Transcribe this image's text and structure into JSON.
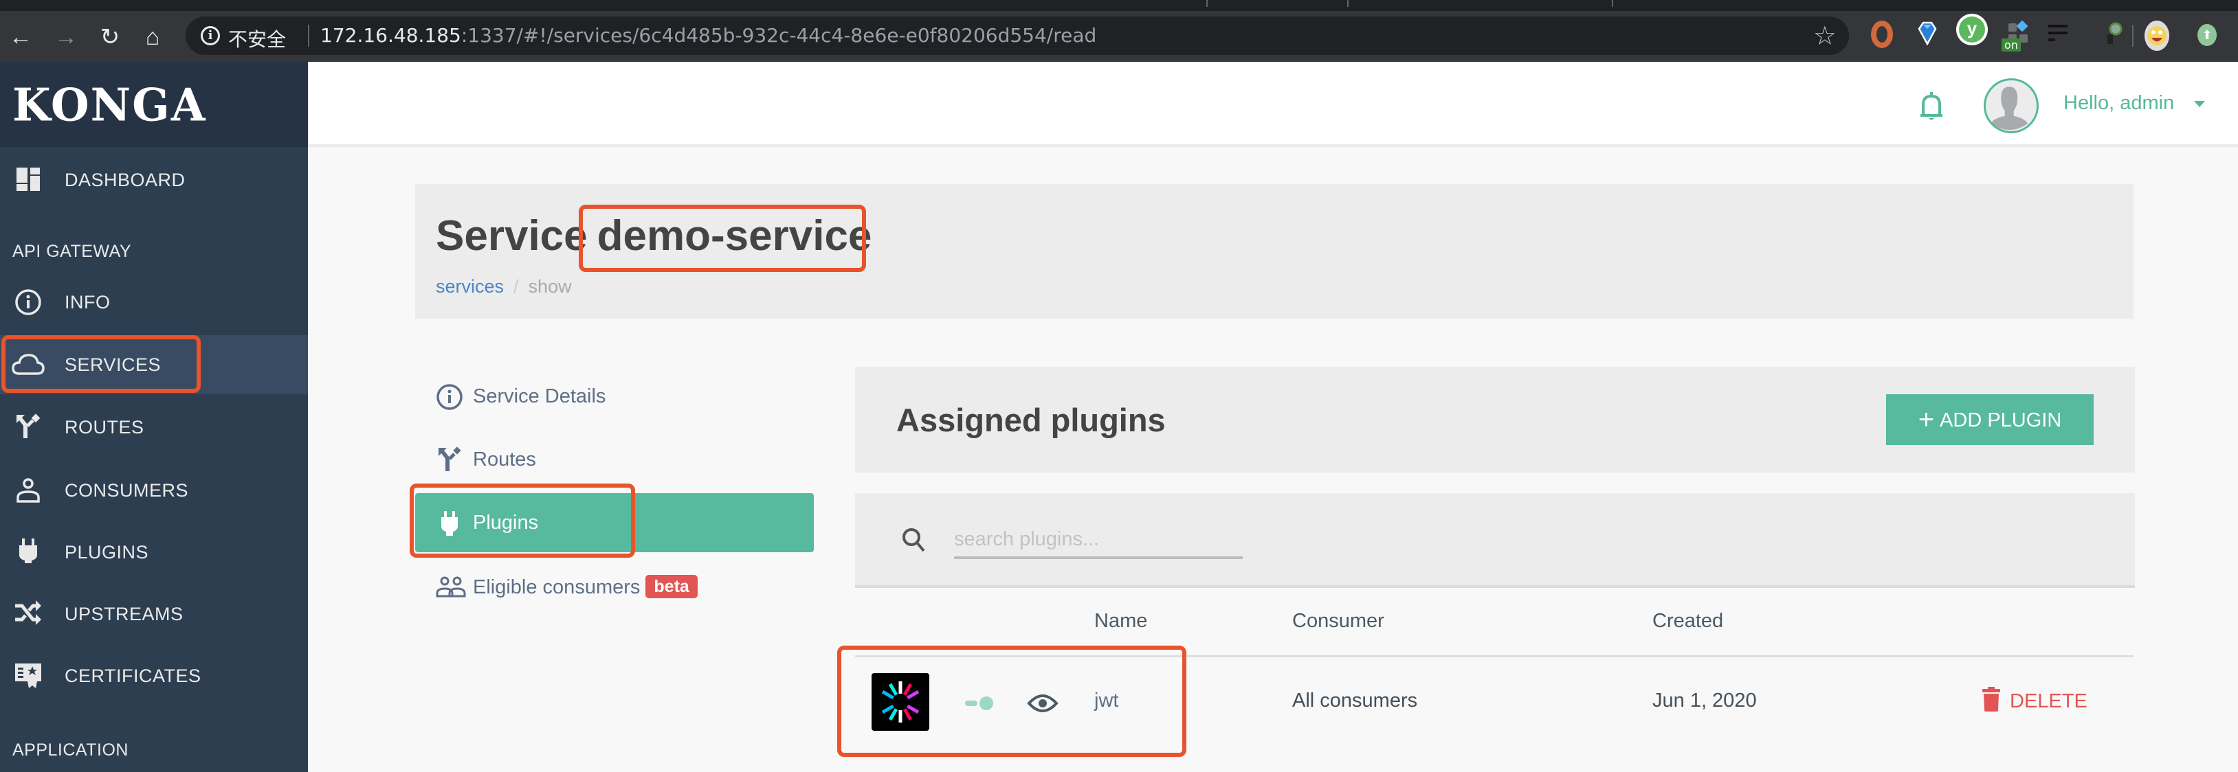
{
  "browser": {
    "nav": {
      "back": "←",
      "forward": "→",
      "reload": "↻",
      "home": "⌂"
    },
    "security_label": "不安全",
    "url_host": "172.16.48.185",
    "url_rest": ":1337/#!/services/6c4d485b-932c-44c4-8e6e-e0f80206d554/read",
    "extensions": [
      "ring-extension",
      "diamond-extension",
      "y-extension",
      "grid-extension",
      "list-extension",
      "loupe-extension",
      "avatar-extension",
      "upload-extension"
    ],
    "ext_badge": "on"
  },
  "sidebar": {
    "brand": "KONGA",
    "items": [
      {
        "label": "DASHBOARD",
        "icon": "dashboard-icon"
      }
    ],
    "sections": [
      {
        "title": "API GATEWAY",
        "items": [
          {
            "label": "INFO",
            "icon": "info-icon"
          },
          {
            "label": "SERVICES",
            "icon": "cloud-icon",
            "active": true
          },
          {
            "label": "ROUTES",
            "icon": "route-icon"
          },
          {
            "label": "CONSUMERS",
            "icon": "person-icon"
          },
          {
            "label": "PLUGINS",
            "icon": "plug-icon"
          },
          {
            "label": "UPSTREAMS",
            "icon": "shuffle-icon"
          },
          {
            "label": "CERTIFICATES",
            "icon": "certificate-icon"
          }
        ]
      },
      {
        "title": "APPLICATION",
        "items": []
      }
    ]
  },
  "header": {
    "greeting": "Hello, admin",
    "notification_icon": "bell-icon"
  },
  "page": {
    "title_prefix": "Service",
    "service_name": "demo-service",
    "breadcrumb": {
      "link": "services",
      "separator": "/",
      "current": "show"
    }
  },
  "subnav": {
    "items": [
      {
        "label": "Service Details",
        "icon": "info-icon"
      },
      {
        "label": "Routes",
        "icon": "route-icon"
      },
      {
        "label": "Plugins",
        "icon": "plug-icon",
        "active": true
      },
      {
        "label": "Eligible consumers",
        "icon": "people-icon",
        "badge": "beta"
      }
    ]
  },
  "plugins_panel": {
    "title": "Assigned plugins",
    "add_button": {
      "plus": "+",
      "label": "ADD PLUGIN"
    },
    "search": {
      "placeholder": "search plugins...",
      "value": ""
    },
    "columns": [
      "Name",
      "Consumer",
      "Created"
    ],
    "rows": [
      {
        "name": "jwt",
        "consumer": "All consumers",
        "created": "Jun 1, 2020",
        "enabled": true,
        "delete_label": "DELETE"
      }
    ]
  },
  "colors": {
    "accent": "#57b99d",
    "sidebar": "#2e3e51",
    "sidebar_brand": "#263345",
    "danger": "#e25555",
    "annotation": "#e8542b",
    "link": "#4a86c5"
  }
}
